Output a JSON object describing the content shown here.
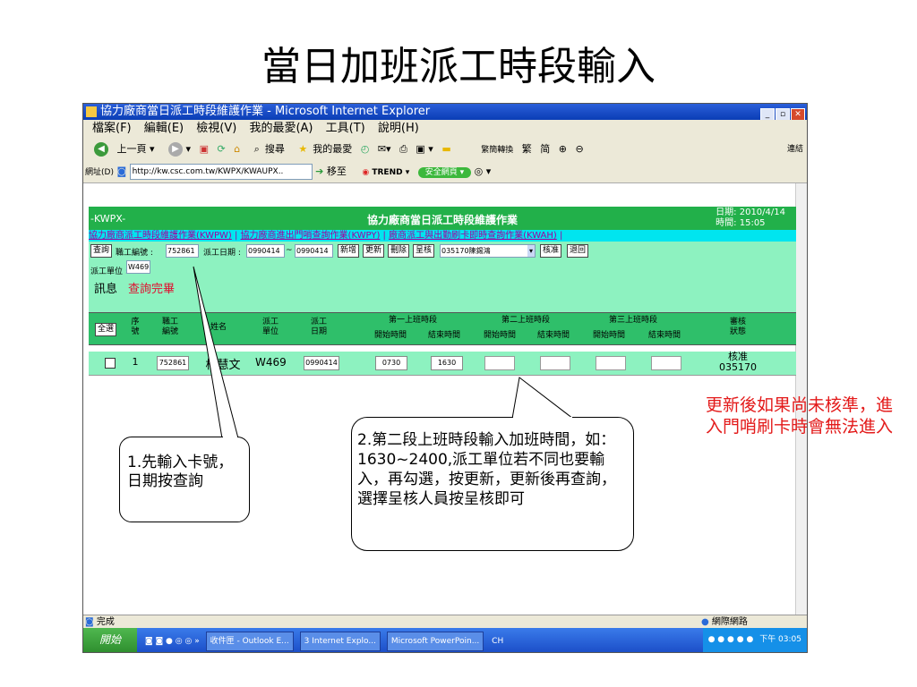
{
  "slide_title": "當日加班派工時段輸入",
  "window": {
    "title": "協力廠商當日派工時段維護作業 - Microsoft Internet Explorer"
  },
  "menu": [
    "檔案(F)",
    "編輯(E)",
    "檢視(V)",
    "我的最愛(A)",
    "工具(T)",
    "說明(H)"
  ],
  "toolbar": {
    "back": "上一頁",
    "search": "搜尋",
    "favorites": "我的最愛",
    "convert": "繁簡轉換",
    "trad": "繁",
    "simp": "简",
    "links": "連結"
  },
  "address": {
    "label": "網址(D)",
    "url": "http://kw.csc.com.tw/KWPX/KWAUPX..",
    "go": "移至",
    "trend": "TREND",
    "safe": "安全網頁"
  },
  "page": {
    "system_code": "-KWPX-",
    "title": "協力廠商當日派工時段維護作業",
    "date_label": "日期:",
    "date": "2010/4/14",
    "time_label": "時間:",
    "time": "15:05",
    "links": [
      "協力廠商派工時段維護作業(KWPW)",
      "協力廠商進出門哨查詢作業(KWPY)",
      "廠商派工與出勤刷卡即時查詢作業(KWAH)"
    ],
    "form": {
      "query_button": "查詢",
      "emp_label": "職工編號 :",
      "emp_value": "752861",
      "date_label": "派工日期 :",
      "date_from": "0990414",
      "date_sep": "~",
      "date_to": "0990414",
      "add_button": "新增",
      "update_button": "更新",
      "delete_button": "刪除",
      "submit_button": "呈核",
      "approver_value": "035170陳錫鴻",
      "approve_button": "核准",
      "return_button": "退回",
      "unit_label": "派工單位 :",
      "unit_value": "W469",
      "msg_label": "訊息",
      "msg_value": "查詢完畢"
    },
    "table": {
      "select_all": "全選",
      "headers": {
        "seq": "序號",
        "emp": "職工編號",
        "name": "姓名",
        "unit": "派工單位",
        "date": "派工日期",
        "shift1": "第一上班時段",
        "shift2": "第二上班時段",
        "shift3": "第三上班時段",
        "start": "開始時間",
        "end": "結束時間",
        "status": "審核狀態"
      },
      "rows": [
        {
          "seq": "1",
          "emp": "752861",
          "name": "楊慧文",
          "unit": "W469",
          "date": "0990414",
          "s1_start": "0730",
          "s1_end": "1630",
          "s2_start": "",
          "s2_end": "",
          "s3_start": "",
          "s3_end": "",
          "status": "核准",
          "approver": "035170"
        }
      ]
    }
  },
  "statusbar": {
    "done": "完成",
    "zone": "網際網路"
  },
  "taskbar": {
    "start": "開始",
    "tasks": [
      "收件匣 - Outlook E...",
      "3 Internet Explo...",
      "Microsoft PowerPoin..."
    ],
    "ime": "CH",
    "clock": "下午 03:05"
  },
  "callouts": {
    "step1": "1.先輸入卡號，日期按查詢",
    "step2": "2.第二段上班時段輸入加班時間，如：1630~2400,派工單位若不同也要輸入，再勾選，按更新，更新後再查詢，選擇呈核人員按呈核即可",
    "note": "更新後如果尚未核準，進入門哨刷卡時會無法進入"
  },
  "colors": {
    "header_green": "#22b04a",
    "form_green": "#8df2c0",
    "link_bar": "#00e5ef",
    "note_red": "#e31a1a"
  }
}
